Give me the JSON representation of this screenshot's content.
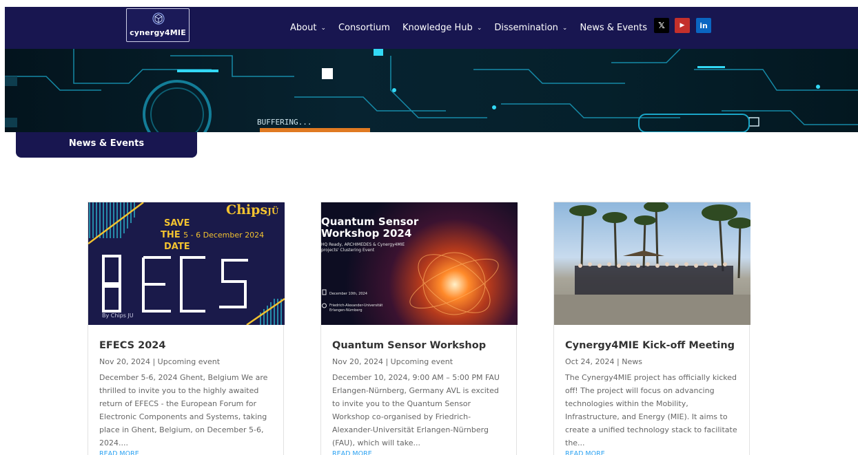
{
  "header": {
    "logo_text": "cynergy4MIE",
    "nav": [
      {
        "label": "About",
        "dropdown": true
      },
      {
        "label": "Consortium",
        "dropdown": false
      },
      {
        "label": "Knowledge Hub",
        "dropdown": true
      },
      {
        "label": "Dissemination",
        "dropdown": true
      },
      {
        "label": "News & Events",
        "dropdown": false
      }
    ],
    "social": [
      {
        "icon": "x-twitter-icon",
        "glyph": "𝕏"
      },
      {
        "icon": "youtube-icon",
        "glyph": "▶"
      },
      {
        "icon": "linkedin-icon",
        "glyph": "in"
      }
    ]
  },
  "banner": {
    "text_buffering": "BUFFERING..."
  },
  "section_tab": {
    "label": "News & Events"
  },
  "cards": [
    {
      "image_lines": {
        "save": "SAVE",
        "the": "THE",
        "date_range": "5 - 6 December 2024",
        "date": "DATE",
        "logo": "Chips",
        "logo_suffix": "JÜ",
        "big": "ECS",
        "by": "By Chips JU"
      },
      "title": "EFECS 2024",
      "date": "Nov 20, 2024",
      "separator": "|",
      "category": "Upcoming event",
      "excerpt": "December 5-6, 2024 Ghent, Belgium We are thrilled to invite you to the highly awaited return of EFECS - the European Forum for Electronic Components and Systems, taking place in Ghent, Belgium, on December 5-6, 2024....",
      "read_more": "READ MORE"
    },
    {
      "image_lines": {
        "title1": "Quantum Sensor",
        "title2": "Workshop 2024",
        "sub1": "HQ Ready, ARCHIMEDES & Cynergy4MIE",
        "sub2": "projects' Clustering Event",
        "date": "December 10th, 2024",
        "loc1": "Friedrich-Alexander-Universität",
        "loc2": "Erlangen-Nürnberg"
      },
      "title": "Quantum Sensor Workshop",
      "date": "Nov 20, 2024",
      "separator": "|",
      "category": "Upcoming event",
      "excerpt": "December 10, 2024, 9:00 AM – 5:00 PM FAU Erlangen-Nürnberg, Germany AVL is excited to invite you to the Quantum Sensor Workshop co-organised by Friedrich-Alexander-Universität Erlangen-Nürnberg (FAU), which will take...",
      "read_more": "READ MORE"
    },
    {
      "title": "Cynergy4MIE Kick-off Meeting",
      "date": "Oct 24, 2024",
      "separator": "|",
      "category": "News",
      "excerpt": "The Cynergy4MIE project has officially kicked off!  The project will focus on advancing technologies within the Mobility, Infrastructure, and Energy (MIE). It aims to create a unified technology stack to facilitate the...",
      "read_more": "READ MORE"
    }
  ],
  "colors": {
    "navy": "#181650",
    "link": "#2ea3f2",
    "accent_yellow": "#f2c230",
    "youtube": "#c4302b",
    "linkedin": "#0a66c2"
  }
}
